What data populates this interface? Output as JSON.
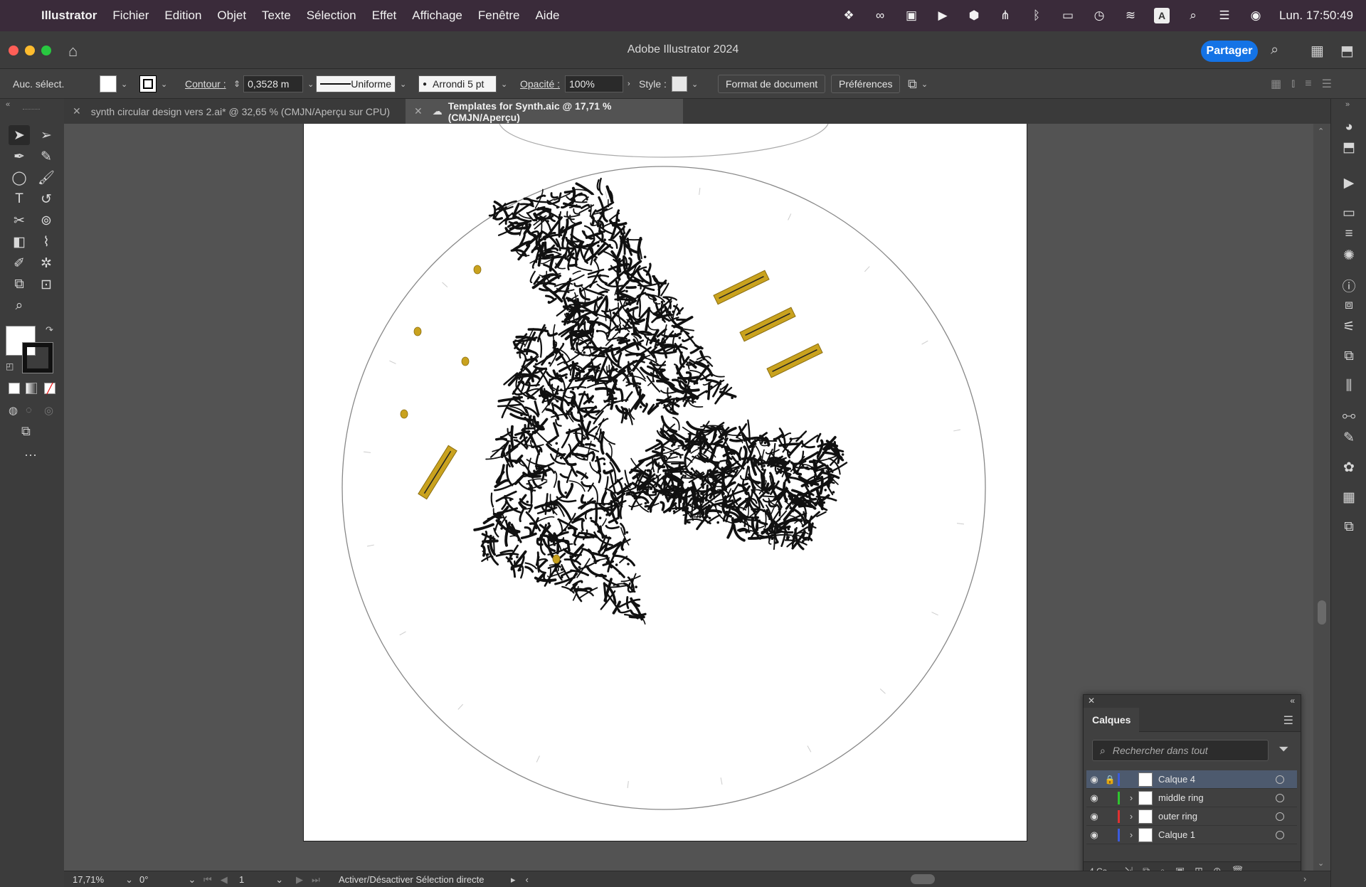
{
  "menubar": {
    "app_name": "Illustrator",
    "items": [
      "Fichier",
      "Edition",
      "Objet",
      "Texte",
      "Sélection",
      "Effet",
      "Affichage",
      "Fenêtre",
      "Aide"
    ],
    "clock": "Lun.  17:50:49",
    "input_letter": "A"
  },
  "window": {
    "title": "Adobe Illustrator 2024",
    "share_label": "Partager",
    "colors": {
      "close": "#ff5f57",
      "minimize": "#febc2e",
      "zoom": "#28c840",
      "accent": "#1473e6"
    }
  },
  "control": {
    "selection": "Auc. sélect.",
    "contour_label": "Contour :",
    "contour_value": "0,3528 m",
    "stroke_profile": "Uniforme",
    "brush": "Arrondi 5 pt",
    "opacity_label": "Opacité :",
    "opacity_value": "100%",
    "style_label": "Style :",
    "doc_format": "Format de document",
    "preferences": "Préférences"
  },
  "tabs": [
    {
      "label": "synth circular design vers 2.ai* @ 32,65 % (CMJN/Aperçu sur CPU)"
    },
    {
      "label": "Templates for Synth.aic @ 17,71 % (CMJN/Aperçu)"
    }
  ],
  "layers": {
    "title": "Calques",
    "search_placeholder": "Rechercher dans tout",
    "rows": [
      {
        "name": "Calque 4",
        "color": "#3b5bdb"
      },
      {
        "name": "middle ring",
        "color": "#2fc52f"
      },
      {
        "name": "outer ring",
        "color": "#e03131"
      },
      {
        "name": "Calque 1",
        "color": "#3b5bdb"
      }
    ],
    "count": "4 Ca..."
  },
  "status": {
    "zoom": "17,71%",
    "rotation": "0°",
    "artboard": "1",
    "action": "Activer/Désactiver Sélection directe"
  },
  "artwork": {
    "gold": "#c9a21e"
  }
}
